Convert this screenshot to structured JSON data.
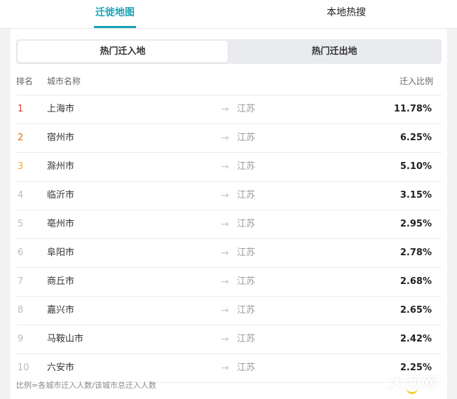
{
  "top_tabs": [
    {
      "label": "迁徙地图"
    },
    {
      "label": "本地热搜"
    }
  ],
  "segment": [
    {
      "label": "热门迁入地"
    },
    {
      "label": "热门迁出地"
    }
  ],
  "table": {
    "headers": {
      "rank": "排名",
      "city": "城市名称",
      "ratio": "迁入比例"
    },
    "arrow_glyph": "→",
    "rows": [
      {
        "rank": "1",
        "city": "上海市",
        "dest": "江苏",
        "ratio": "11.78%"
      },
      {
        "rank": "2",
        "city": "宿州市",
        "dest": "江苏",
        "ratio": "6.25%"
      },
      {
        "rank": "3",
        "city": "滁州市",
        "dest": "江苏",
        "ratio": "5.10%"
      },
      {
        "rank": "4",
        "city": "临沂市",
        "dest": "江苏",
        "ratio": "3.15%"
      },
      {
        "rank": "5",
        "city": "亳州市",
        "dest": "江苏",
        "ratio": "2.95%"
      },
      {
        "rank": "6",
        "city": "阜阳市",
        "dest": "江苏",
        "ratio": "2.78%"
      },
      {
        "rank": "7",
        "city": "商丘市",
        "dest": "江苏",
        "ratio": "2.68%"
      },
      {
        "rank": "8",
        "city": "嘉兴市",
        "dest": "江苏",
        "ratio": "2.65%"
      },
      {
        "rank": "9",
        "city": "马鞍山市",
        "dest": "江苏",
        "ratio": "2.42%"
      },
      {
        "rank": "10",
        "city": "六安市",
        "dest": "江苏",
        "ratio": "2.25%"
      }
    ]
  },
  "footnote": "比例=各城市迁入人数/该城市总迁入人数",
  "watermark": "大河网",
  "colors": {
    "accent": "#1aa3b5",
    "rank_1": "#e53935",
    "rank_2": "#ef6c00",
    "rank_3": "#f5a623",
    "rank_other": "#bbbbbb"
  }
}
